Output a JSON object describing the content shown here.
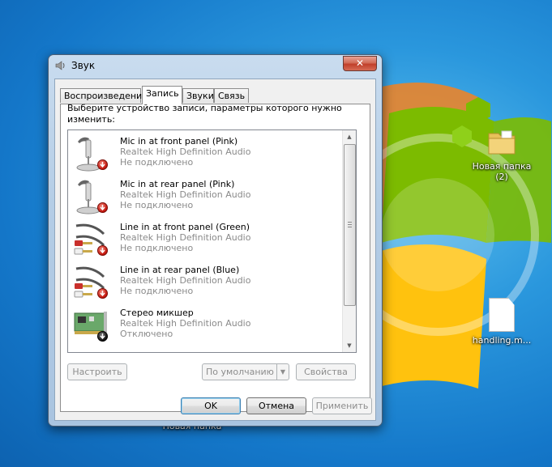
{
  "desktop": {
    "icons": [
      {
        "label": "Новая папка (2)",
        "icon": "folder-icon"
      },
      {
        "label": "handling.m...",
        "icon": "file-icon"
      },
      {
        "label": "Новая папка",
        "icon": "folder-icon"
      }
    ]
  },
  "window": {
    "title": "Звук",
    "title_icon": "speaker-icon",
    "close_glyph": "✕",
    "tabs": [
      {
        "label": "Воспроизведение",
        "active": false
      },
      {
        "label": "Запись",
        "active": true
      },
      {
        "label": "Звуки",
        "active": false
      },
      {
        "label": "Связь",
        "active": false
      }
    ],
    "instruction": "Выберите устройство записи, параметры которого нужно изменить:",
    "devices": [
      {
        "name": "Mic in at front panel (Pink)",
        "driver": "Realtek High Definition Audio",
        "status": "Не подключено",
        "icon": "microphone-icon",
        "badge": "red-down-arrow"
      },
      {
        "name": "Mic in at rear panel (Pink)",
        "driver": "Realtek High Definition Audio",
        "status": "Не подключено",
        "icon": "microphone-icon",
        "badge": "red-down-arrow"
      },
      {
        "name": "Line in at front panel (Green)",
        "driver": "Realtek High Definition Audio",
        "status": "Не подключено",
        "icon": "rca-cable-icon",
        "badge": "red-down-arrow"
      },
      {
        "name": "Line in at rear panel (Blue)",
        "driver": "Realtek High Definition Audio",
        "status": "Не подключено",
        "icon": "rca-cable-icon",
        "badge": "red-down-arrow"
      },
      {
        "name": "Стерео микшер",
        "driver": "Realtek High Definition Audio",
        "status": "Отключено",
        "icon": "sound-card-icon",
        "badge": "black-down-arrow"
      }
    ],
    "buttons": {
      "configure": "Настроить",
      "default": "По умолчанию",
      "properties": "Свойства",
      "ok": "OK",
      "cancel": "Отмена",
      "apply": "Применить"
    }
  },
  "colors": {
    "desktop_blue": "#1477c9",
    "title_glass": "#b4cde6",
    "close_red": "#c1402b"
  }
}
